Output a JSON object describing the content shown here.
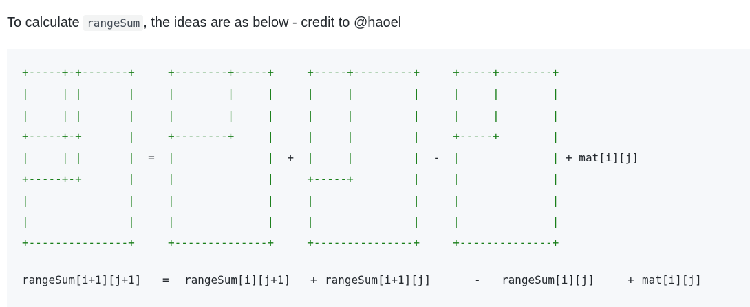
{
  "intro": {
    "before": "To calculate ",
    "code": "rangeSum",
    "after": ", the ideas are as below - credit to @haoel"
  },
  "diagram": {
    "line_color": "#1a7f1a",
    "lines": [
      "+-----+-+-------+     +--------+-----+     +-----+---------+     +-----+--------+",
      "|     | |       |     |        |     |     |     |         |     |     |        |",
      "|     | |       |     |        |     |     |     |         |     |     |        |",
      "+-----+-+       |     +--------+     |     |     |         |     +-----+        |",
      "|     | |       |  =  |              |  +  |     |         |  -  |              | + mat[i][j]",
      "+-----+-+       |     |              |     +-----+         |     |              |",
      "|               |     |              |     |               |     |              |",
      "|               |     |              |     |               |     |              |",
      "+---------------+     +--------------+     +---------------+     +--------------+"
    ]
  },
  "formula": {
    "target": "rangeSum[i+1][j+1]",
    "eq": "=",
    "term1": "rangeSum[i][j+1]",
    "plus1": "+",
    "term2": "rangeSum[i+1][j]",
    "minus": "-",
    "term3": "rangeSum[i][j]",
    "plus2": "+",
    "term4": "mat[i][j]"
  }
}
